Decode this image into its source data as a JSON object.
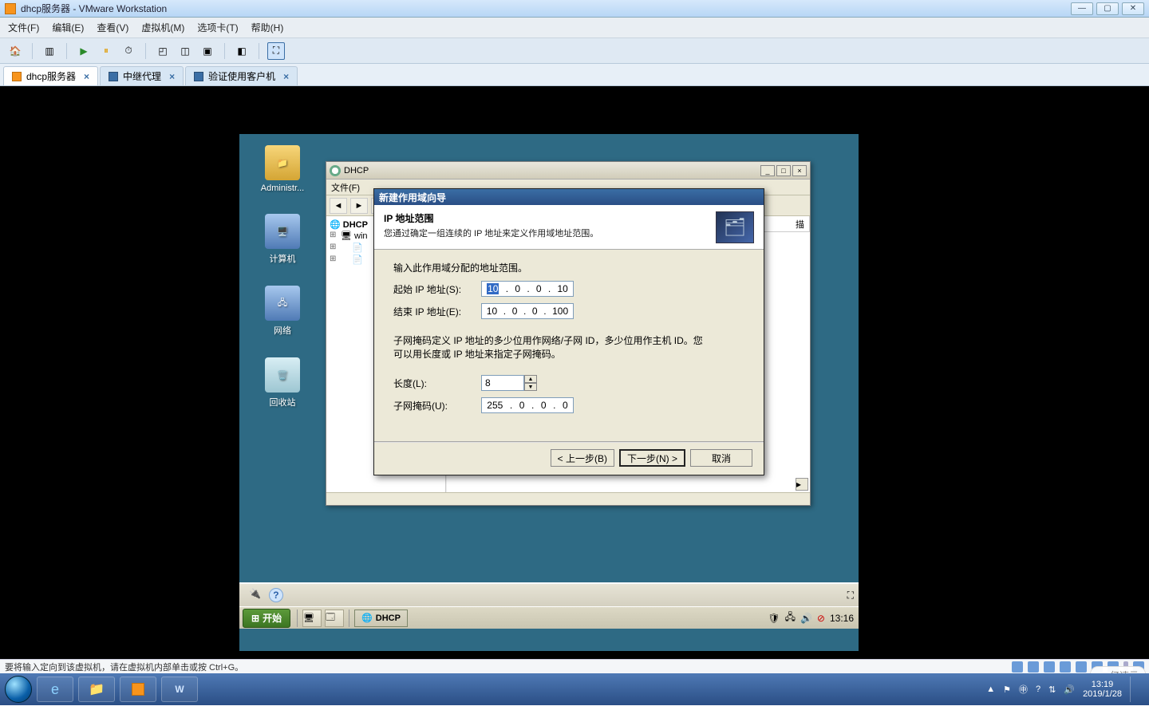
{
  "outerWindow": {
    "title": "dhcp服务器 - VMware Workstation"
  },
  "vmMenu": [
    "文件(F)",
    "编辑(E)",
    "查看(V)",
    "虚拟机(M)",
    "选项卡(T)",
    "帮助(H)"
  ],
  "vmTabs": [
    {
      "label": "dhcp服务器",
      "active": true
    },
    {
      "label": "中继代理",
      "active": false
    },
    {
      "label": "验证使用客户机",
      "active": false
    }
  ],
  "guest": {
    "desktopIcons": [
      {
        "label": "Administr..."
      },
      {
        "label": "计算机"
      },
      {
        "label": "网络"
      },
      {
        "label": "回收站"
      }
    ],
    "dhcpWindow": {
      "title": "DHCP",
      "menus": [
        "文件(F)"
      ],
      "tree": {
        "root": "DHCP",
        "child1": "win",
        "leafGlyph": "⊞"
      },
      "rightHeader": "描"
    },
    "wizard": {
      "title": "新建作用域向导",
      "headerTitle": "IP 地址范围",
      "headerDesc": "您通过确定一组连续的 IP 地址来定义作用域地址范围。",
      "line1": "输入此作用域分配的地址范围。",
      "startLabel": "起始 IP 地址(S):",
      "startIp": {
        "o1": "10",
        "o2": "0",
        "o3": "0",
        "o4": "10",
        "selectedOctet": 1
      },
      "endLabel": "结束 IP 地址(E):",
      "endIp": {
        "o1": "10",
        "o2": "0",
        "o3": "0",
        "o4": "100"
      },
      "subnetNote1": "子网掩码定义 IP 地址的多少位用作网络/子网 ID，多少位用作主机 ID。您",
      "subnetNote2": "可以用长度或 IP 地址来指定子网掩码。",
      "lengthLabel": "长度(L):",
      "lengthValue": "8",
      "maskLabel": "子网掩码(U):",
      "maskIp": {
        "o1": "255",
        "o2": "0",
        "o3": "0",
        "o4": "0"
      },
      "buttons": {
        "back": "< 上一步(B)",
        "next": "下一步(N) >",
        "cancel": "取消"
      }
    },
    "taskbar": {
      "start": "开始",
      "task": "DHCP",
      "clock": "13:16"
    }
  },
  "hostStatus": "要将输入定向到该虚拟机，请在虚拟机内部单击或按 Ctrl+G。",
  "host": {
    "clockTime": "13:19",
    "clockDate": "2019/1/28"
  },
  "watermark": "亿速云"
}
